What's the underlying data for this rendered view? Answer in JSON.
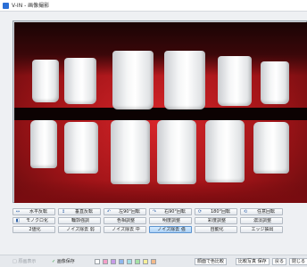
{
  "window": {
    "title": "V-IN - 画像撮影"
  },
  "image": {
    "alt": "歯列の画像"
  },
  "toolbar": {
    "row1": [
      {
        "icon": "↔",
        "icon_name": "flip-horizontal-icon",
        "label": "水平反転"
      },
      {
        "icon": "↕",
        "icon_name": "flip-vertical-icon",
        "label": "垂直反転"
      },
      {
        "icon": "↶",
        "icon_name": "rotate-left-icon",
        "label": "左90°回転"
      },
      {
        "icon": "↷",
        "icon_name": "rotate-right-icon",
        "label": "右90°回転"
      },
      {
        "icon": "⟳",
        "icon_name": "rotate-180-icon",
        "label": "180°回転"
      },
      {
        "icon": "⟲",
        "icon_name": "free-rotate-icon",
        "label": "任意回転"
      }
    ],
    "row2": [
      {
        "icon": "◧",
        "icon_name": "monochrome-icon",
        "label": "モノクロ化"
      },
      {
        "label": "輪郭強調"
      },
      {
        "label": "色相調整"
      },
      {
        "label": "明度調整"
      },
      {
        "label": "彩度調整"
      },
      {
        "label": "濃淡調整"
      }
    ],
    "row3": [
      {
        "label": "2値化"
      },
      {
        "label": "ノイズ除去 弱"
      },
      {
        "label": "ノイズ除去 中"
      },
      {
        "label": "ノイズ除去 強"
      },
      {
        "label": "自動化"
      },
      {
        "label": "エッジ抽出"
      }
    ]
  },
  "bottom_bar": {
    "original_view": "原画表示",
    "image_save": "画像保存",
    "swatch_colors": [
      "#ffffff",
      "#f3a0c8",
      "#c89be8",
      "#8fb8ef",
      "#9fe0e6",
      "#a6e3a6",
      "#f7ef9a",
      "#f3b98a"
    ],
    "registered_colors_label": "顔面で色比較",
    "comparison_label": "比較写真 保存",
    "back_label": "戻る",
    "close_label": "閉じる"
  },
  "colors": {
    "accent": "#2b6fd6",
    "gum_red": "#c41d22",
    "active_button": "#aad0f5"
  }
}
